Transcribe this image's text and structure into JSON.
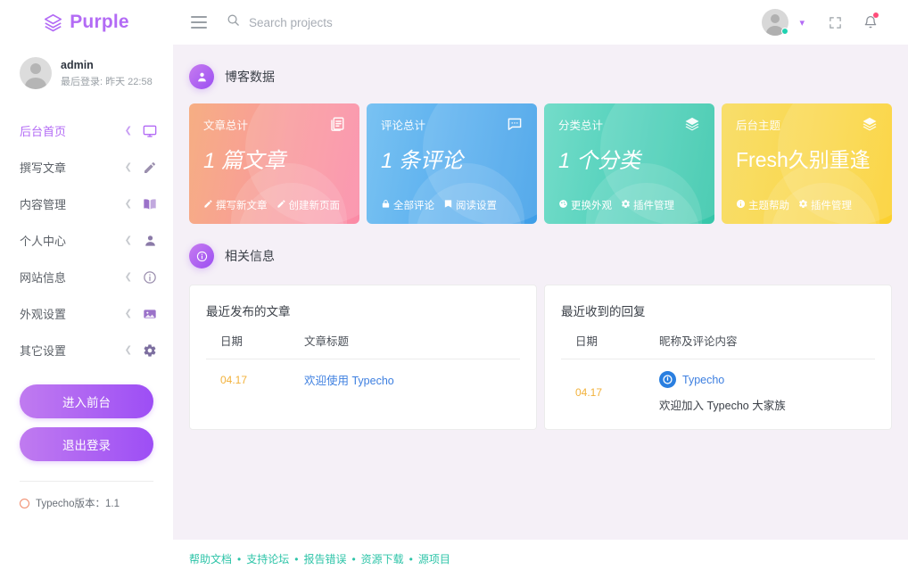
{
  "brand": {
    "name": "Purple",
    "icon": "layers-icon"
  },
  "user": {
    "name": "admin",
    "last_login": "最后登录: 昨天 22:58",
    "avatar": "user-avatar"
  },
  "sidebar": {
    "items": [
      {
        "label": "后台首页",
        "icon": "monitor-icon",
        "active": true
      },
      {
        "label": "撰写文章",
        "icon": "pencil-icon",
        "active": false
      },
      {
        "label": "内容管理",
        "icon": "book-icon",
        "active": false
      },
      {
        "label": "个人中心",
        "icon": "person-icon",
        "active": false
      },
      {
        "label": "网站信息",
        "icon": "info-circle-icon",
        "active": false
      },
      {
        "label": "外观设置",
        "icon": "image-icon",
        "active": false
      },
      {
        "label": "其它设置",
        "icon": "gear-icon",
        "active": false
      }
    ],
    "arrow_icon": "chevron-left-icon",
    "buttons": {
      "frontend": "进入前台",
      "logout": "退出登录"
    },
    "version": "Typecho版本：1.1"
  },
  "topbar": {
    "menu_icon": "hamburger-icon",
    "search": {
      "icon": "search-icon",
      "placeholder": "Search projects",
      "value": ""
    },
    "avatar": "user-avatar",
    "online_status": "online",
    "chevron": "chevron-down-icon",
    "fullscreen_icon": "fullscreen-icon",
    "bell_icon": "bell-icon",
    "bell_badge": true
  },
  "sections": {
    "blog_data": {
      "title": "博客数据",
      "icon": "person-icon"
    },
    "related_info": {
      "title": "相关信息",
      "icon": "info-circle-icon"
    }
  },
  "cards": [
    {
      "label": "文章总计",
      "value": "1 篇文章",
      "icon": "article-icon",
      "italic": true,
      "gradient_from": "#f6ae83",
      "gradient_to": "#fb8aa6",
      "links": [
        {
          "icon": "pencil-icon",
          "label": "撰写新文章"
        },
        {
          "icon": "pencil-icon",
          "label": "创建新页面"
        }
      ]
    },
    {
      "label": "评论总计",
      "value": "1 条评论",
      "icon": "comment-icon",
      "italic": true,
      "gradient_from": "#79c2f2",
      "gradient_to": "#3e9ee8",
      "links": [
        {
          "icon": "lock-icon",
          "label": "全部评论"
        },
        {
          "icon": "book-icon",
          "label": "阅读设置"
        }
      ]
    },
    {
      "label": "分类总计",
      "value": "1 个分类",
      "icon": "layers-icon",
      "italic": true,
      "gradient_from": "#74dcc9",
      "gradient_to": "#35c6a9",
      "links": [
        {
          "icon": "palette-icon",
          "label": "更换外观"
        },
        {
          "icon": "gear-icon",
          "label": "插件管理"
        }
      ]
    },
    {
      "label": "后台主题",
      "value": "Fresh久别重逢",
      "icon": "layers-icon",
      "italic": false,
      "gradient_from": "#f8de6c",
      "gradient_to": "#fbd02d",
      "links": [
        {
          "icon": "info-circle-icon",
          "label": "主题帮助"
        },
        {
          "icon": "gear-icon",
          "label": "插件管理"
        }
      ]
    }
  ],
  "panels": {
    "recent_posts": {
      "title": "最近发布的文章",
      "columns": [
        "日期",
        "文章标题"
      ],
      "rows": [
        {
          "date": "04.17",
          "title": "欢迎使用 Typecho"
        }
      ]
    },
    "recent_replies": {
      "title": "最近收到的回复",
      "columns": [
        "日期",
        "昵称及评论内容"
      ],
      "rows": [
        {
          "date": "04.17",
          "author": "Typecho",
          "author_icon": "typecho-logo-icon",
          "text": "欢迎加入 Typecho 大家族"
        }
      ]
    }
  },
  "footer": {
    "links": [
      "帮助文档",
      "支持论坛",
      "报告错误",
      "资源下载",
      "源项目"
    ],
    "separator": "•"
  },
  "colors": {
    "brand_purple": "#b36bf5",
    "content_bg": "#f5f0f7",
    "footer_link": "#2ec4a8",
    "date_orange": "#f2b23c",
    "post_link_blue": "#3d7fe0"
  }
}
